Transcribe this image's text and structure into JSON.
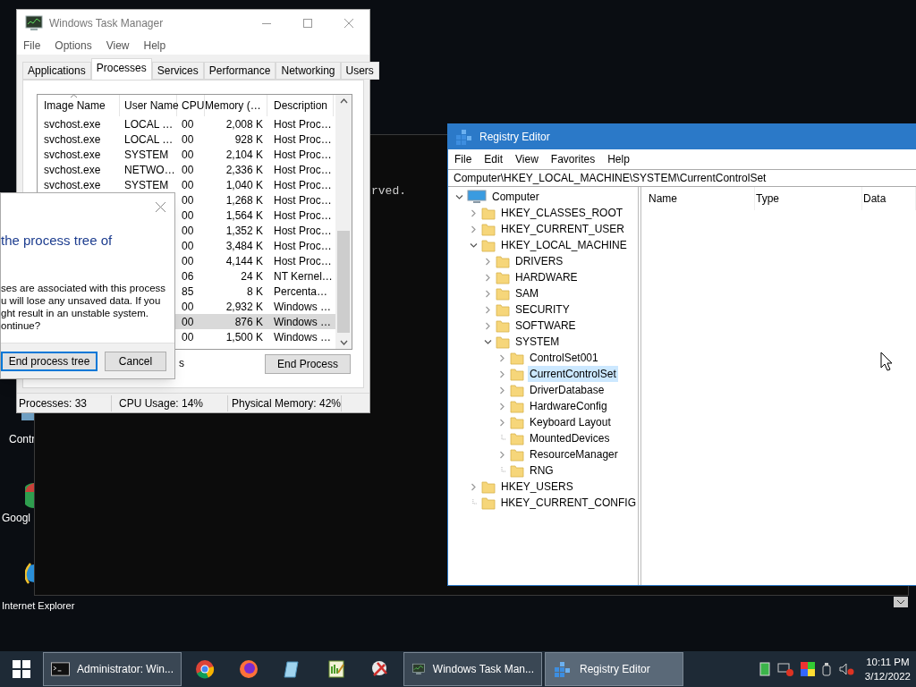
{
  "desktop": {
    "icons": [
      {
        "label": "Contr",
        "kind": "control"
      },
      {
        "label": "Googl",
        "kind": "chrome"
      },
      {
        "label": "Internet Explorer",
        "kind": "ie"
      }
    ]
  },
  "console": {
    "text": "rved."
  },
  "task_manager": {
    "title": "Windows Task Manager",
    "menu": [
      "File",
      "Options",
      "View",
      "Help"
    ],
    "tabs": [
      {
        "label": "Applications",
        "selected": false
      },
      {
        "label": "Processes",
        "selected": true
      },
      {
        "label": "Services",
        "selected": false
      },
      {
        "label": "Performance",
        "selected": false
      },
      {
        "label": "Networking",
        "selected": false
      },
      {
        "label": "Users",
        "selected": false
      }
    ],
    "columns": [
      "Image Name",
      "User Name",
      "CPU",
      "Memory (…",
      "Description"
    ],
    "rows": [
      {
        "image_name": "svchost.exe",
        "user_name": "LOCAL …",
        "cpu": "00",
        "memory": "2,008 K",
        "description": "Host Proc…",
        "selected": false
      },
      {
        "image_name": "svchost.exe",
        "user_name": "LOCAL …",
        "cpu": "00",
        "memory": "928 K",
        "description": "Host Proc…",
        "selected": false
      },
      {
        "image_name": "svchost.exe",
        "user_name": "SYSTEM",
        "cpu": "00",
        "memory": "2,104 K",
        "description": "Host Proc…",
        "selected": false
      },
      {
        "image_name": "svchost.exe",
        "user_name": "NETWO…",
        "cpu": "00",
        "memory": "2,336 K",
        "description": "Host Proc…",
        "selected": false
      },
      {
        "image_name": "svchost.exe",
        "user_name": "SYSTEM",
        "cpu": "00",
        "memory": "1,040 K",
        "description": "Host Proc…",
        "selected": false
      },
      {
        "cpu": "00",
        "memory": "1,268 K",
        "description": "Host Proc…",
        "selected": false
      },
      {
        "cpu": "00",
        "memory": "1,564 K",
        "description": "Host Proc…",
        "selected": false
      },
      {
        "cpu": "00",
        "memory": "1,352 K",
        "description": "Host Proc…",
        "selected": false
      },
      {
        "cpu": "00",
        "memory": "3,484 K",
        "description": "Host Proc…",
        "selected": false
      },
      {
        "cpu": "00",
        "memory": "4,144 K",
        "description": "Host Proc…",
        "selected": false
      },
      {
        "cpu": "06",
        "memory": "24 K",
        "description": "NT Kernel…",
        "selected": false
      },
      {
        "cpu": "85",
        "memory": "8 K",
        "description": "Percenta…",
        "selected": false
      },
      {
        "cpu": "00",
        "memory": "2,932 K",
        "description": "Windows …",
        "selected": false
      },
      {
        "cpu": "00",
        "memory": "876 K",
        "description": "Windows …",
        "selected": true
      },
      {
        "cpu": "00",
        "memory": "1,500 K",
        "description": "Windows …",
        "selected": false
      }
    ],
    "checkbox_label_tail": "s",
    "end_process_button": "End Process",
    "status_bar": [
      "Processes: 33",
      "CPU Usage: 14%",
      "Physical Memory: 42%"
    ]
  },
  "dialog": {
    "title": "the process tree of",
    "body": [
      "ses are associated with this process",
      "u will lose any unsaved data. If you",
      "ght result in an unstable system.",
      "ontinue?"
    ],
    "buttons": [
      {
        "label": "End process tree",
        "focused": true
      },
      {
        "label": "Cancel",
        "focused": false
      }
    ]
  },
  "registry_editor": {
    "title": "Registry Editor",
    "menu": [
      "File",
      "Edit",
      "View",
      "Favorites",
      "Help"
    ],
    "address": "Computer\\HKEY_LOCAL_MACHINE\\SYSTEM\\CurrentControlSet",
    "columns": [
      "Name",
      "Type",
      "Data"
    ],
    "tree": [
      {
        "label": "Computer",
        "kind": "computer",
        "expanded": true,
        "selected": false,
        "children": [
          {
            "label": "HKEY_CLASSES_ROOT",
            "kind": "folder",
            "expanded": false,
            "selected": false
          },
          {
            "label": "HKEY_CURRENT_USER",
            "kind": "folder",
            "expanded": false,
            "selected": false
          },
          {
            "label": "HKEY_LOCAL_MACHINE",
            "kind": "folder",
            "expanded": true,
            "selected": false,
            "children": [
              {
                "label": "DRIVERS",
                "kind": "folder",
                "expanded": false,
                "selected": false
              },
              {
                "label": "HARDWARE",
                "kind": "folder",
                "expanded": false,
                "selected": false
              },
              {
                "label": "SAM",
                "kind": "folder",
                "expanded": false,
                "selected": false
              },
              {
                "label": "SECURITY",
                "kind": "folder",
                "expanded": false,
                "selected": false
              },
              {
                "label": "SOFTWARE",
                "kind": "folder",
                "expanded": false,
                "selected": false
              },
              {
                "label": "SYSTEM",
                "kind": "folder",
                "expanded": true,
                "selected": false,
                "children": [
                  {
                    "label": "ControlSet001",
                    "kind": "folder",
                    "expanded": false,
                    "selected": false
                  },
                  {
                    "label": "CurrentControlSet",
                    "kind": "folder",
                    "expanded": false,
                    "selected": true
                  },
                  {
                    "label": "DriverDatabase",
                    "kind": "folder",
                    "expanded": false,
                    "selected": false
                  },
                  {
                    "label": "HardwareConfig",
                    "kind": "folder",
                    "expanded": false,
                    "selected": false
                  },
                  {
                    "label": "Keyboard Layout",
                    "kind": "folder",
                    "expanded": false,
                    "selected": false
                  },
                  {
                    "label": "MountedDevices",
                    "kind": "folder",
                    "selected": false
                  },
                  {
                    "label": "ResourceManager",
                    "kind": "folder",
                    "expanded": false,
                    "selected": false
                  },
                  {
                    "label": "RNG",
                    "kind": "folder",
                    "selected": false
                  }
                ]
              }
            ]
          },
          {
            "label": "HKEY_USERS",
            "kind": "folder",
            "expanded": false,
            "selected": false
          },
          {
            "label": "HKEY_CURRENT_CONFIG",
            "kind": "folder",
            "selected": false
          }
        ]
      }
    ]
  },
  "taskbar": {
    "items": [
      {
        "kind": "console",
        "label": "Administrator: Win...",
        "open": true,
        "active": false
      },
      {
        "kind": "chrome",
        "open": false,
        "active": false
      },
      {
        "kind": "firefox",
        "open": false,
        "active": false
      },
      {
        "kind": "notepad",
        "open": false,
        "active": false
      },
      {
        "kind": "chart",
        "open": false,
        "active": false
      },
      {
        "kind": "scissors",
        "open": false,
        "active": false
      },
      {
        "kind": "taskmgr",
        "label": "Windows Task Man...",
        "open": true,
        "active": false
      },
      {
        "kind": "regedit",
        "label": "Registry Editor",
        "open": true,
        "active": true
      }
    ],
    "time": "10:11 PM",
    "date": "3/12/2022"
  }
}
